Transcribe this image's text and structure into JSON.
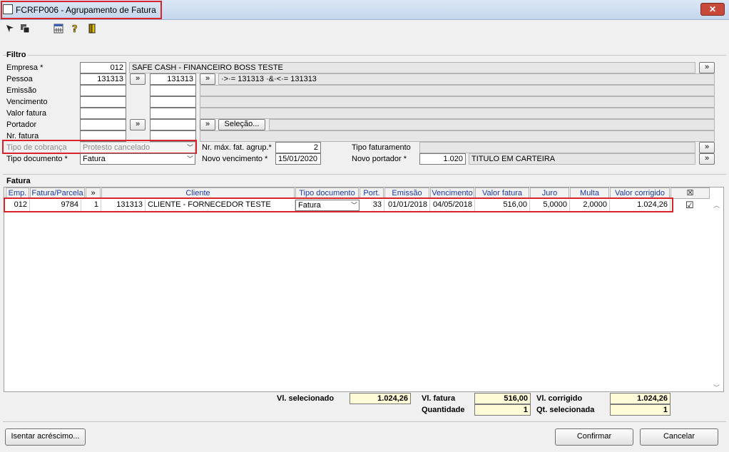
{
  "window": {
    "title": "FCRFP006 - Agrupamento de Fatura",
    "close_label": "✕"
  },
  "toolbar": {
    "icons": [
      "cursor-icon",
      "copy-icon",
      "calculator-icon",
      "help-icon",
      "exit-door-icon"
    ]
  },
  "filtro": {
    "title": "Filtro",
    "empresa": {
      "label": "Empresa *",
      "code": "012",
      "name": "SAFE CASH - FINANCEIRO BOSS TESTE"
    },
    "pessoa": {
      "label": "Pessoa",
      "from": "131313",
      "to": "131313",
      "expr": "·>·= 131313 ·&·<·= 131313"
    },
    "emissao": {
      "label": "Emissão"
    },
    "vencimento": {
      "label": "Vencimento"
    },
    "valor_fatura": {
      "label": "Valor fatura"
    },
    "portador": {
      "label": "Portador",
      "selecao_label": "Seleção..."
    },
    "nr_fatura": {
      "label": "Nr. fatura"
    },
    "tipo_cobranca": {
      "label": "Tipo de cobrança",
      "value": "Protesto cancelado"
    },
    "tipo_documento": {
      "label": "Tipo documento *",
      "value": "Fatura"
    },
    "nr_max": {
      "label": "Nr. máx. fat. agrup.*",
      "value": "2"
    },
    "novo_vencimento": {
      "label": "Novo vencimento *",
      "value": "15/01/2020"
    },
    "tipo_faturamento": {
      "label": "Tipo faturamento",
      "value": ""
    },
    "novo_portador": {
      "label": "Novo portador *",
      "code": "1.020",
      "name": "TITULO EM CARTEIRA"
    },
    "expand_symbol": "»"
  },
  "fatura": {
    "title": "Fatura",
    "columns": [
      "Emp.",
      "Fatura/Parcela",
      "»",
      "Cliente",
      "Tipo documento",
      "Port.",
      "Emissão",
      "Vencimento",
      "Valor fatura",
      "Juro",
      "Multa",
      "Valor corrigido",
      "☒"
    ],
    "rows": [
      {
        "emp": "012",
        "fatura": "9784",
        "parcela": "1",
        "cliente_code": "131313",
        "cliente_name": "CLIENTE - FORNECEDOR TESTE",
        "tipo_documento": "Fatura",
        "port": "33",
        "emissao": "01/01/2018",
        "vencimento": "04/05/2018",
        "valor_fatura": "516,00",
        "juro": "5,0000",
        "multa": "2,0000",
        "valor_corrigido": "1.024,26",
        "selected": "☑"
      }
    ]
  },
  "totals": {
    "vl_selecionado": {
      "label": "Vl. selecionado",
      "value": "1.024,26"
    },
    "vl_fatura": {
      "label": "Vl. fatura",
      "value": "516,00"
    },
    "quantidade": {
      "label": "Quantidade",
      "value": "1"
    },
    "vl_corrigido": {
      "label": "Vl. corrigido",
      "value": "1.024,26"
    },
    "qt_selecionada": {
      "label": "Qt. selecionada",
      "value": "1"
    }
  },
  "buttons": {
    "isentar": "Isentar acréscimo...",
    "confirmar": "Confirmar",
    "cancelar": "Cancelar"
  },
  "colors": {
    "highlight": "#d9242b",
    "header_text": "#1a3aa8",
    "totals_bg": "#fffbd6"
  }
}
